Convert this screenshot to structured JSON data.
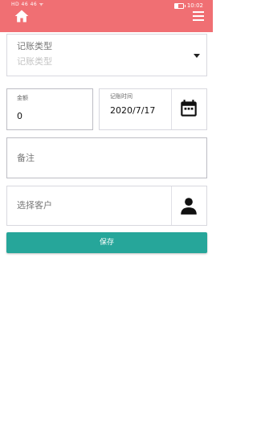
{
  "status_bar": {
    "left_indicators": "HD 46 46 ᯤ",
    "time": "10:02",
    "battery_level": 0.45
  },
  "header": {
    "home_icon": "home-icon",
    "menu_icon": "menu-icon",
    "background_color": "#f06f73"
  },
  "form": {
    "record_type": {
      "label": "记账类型",
      "placeholder": "记账类型"
    },
    "amount": {
      "label": "金额",
      "value": "0"
    },
    "record_time": {
      "label": "记账时间",
      "value": "2020/7/17",
      "icon": "calendar-icon"
    },
    "remark": {
      "placeholder": "备注"
    },
    "customer": {
      "placeholder": "选择客户",
      "icon": "person-icon"
    },
    "save_label": "保存",
    "accent_color": "#26a69a"
  }
}
